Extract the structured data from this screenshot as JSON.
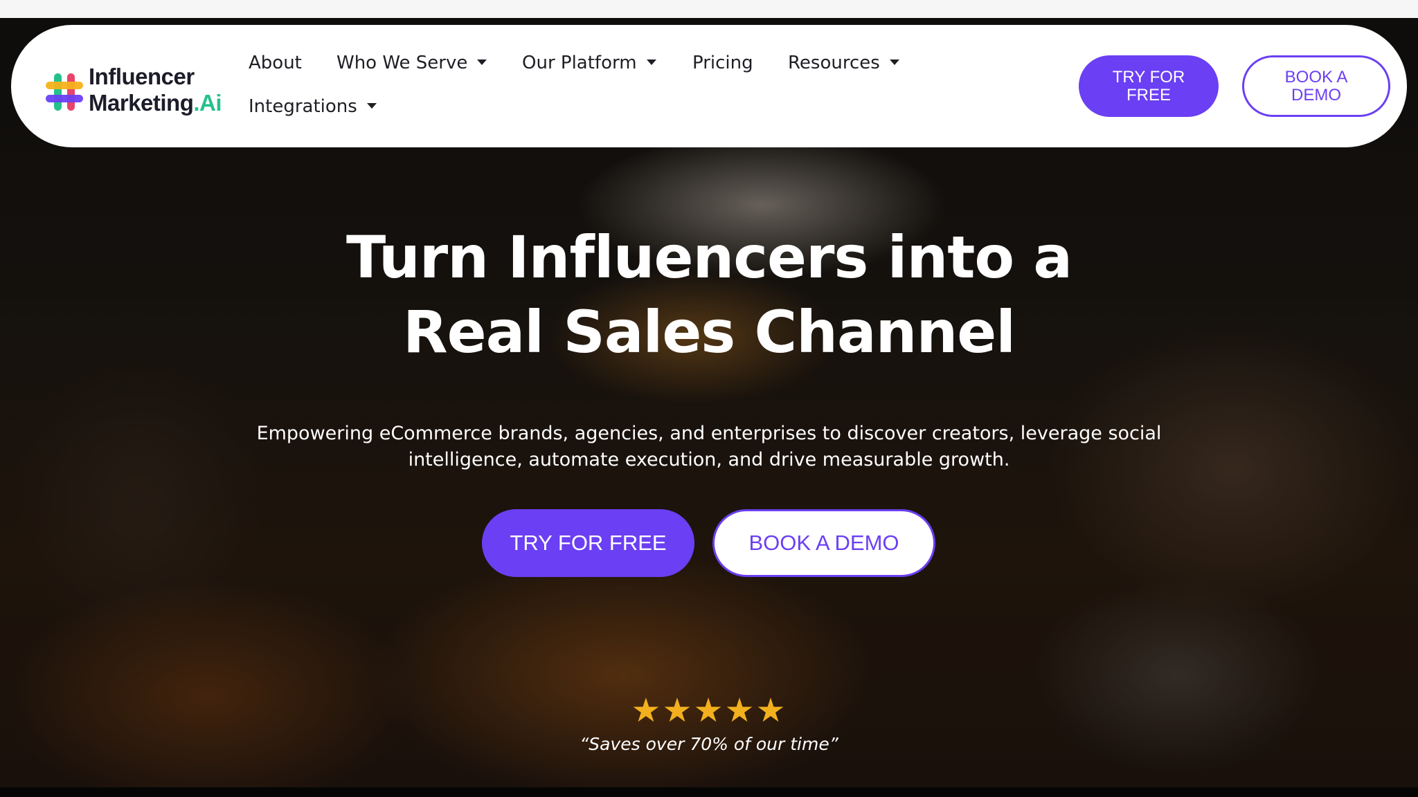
{
  "brand": {
    "name_line1": "Influencer",
    "name_line2": "Marketing",
    "name_suffix": ".Ai",
    "accent_color": "#6b3ff3",
    "logo_colors": [
      "#25c18b",
      "#e8456b",
      "#f6b21c",
      "#6b3ff3"
    ]
  },
  "nav": {
    "items": [
      {
        "label": "About",
        "has_dropdown": false
      },
      {
        "label": "Who We Serve",
        "has_dropdown": true
      },
      {
        "label": "Our Platform",
        "has_dropdown": true
      },
      {
        "label": "Pricing",
        "has_dropdown": false
      },
      {
        "label": "Resources",
        "has_dropdown": true
      },
      {
        "label": "Integrations",
        "has_dropdown": true
      }
    ],
    "try_line1": "TRY FOR",
    "try_line2": "FREE",
    "demo_line1": "BOOK A",
    "demo_line2": "DEMO"
  },
  "hero": {
    "headline_line1": "Turn Influencers into a",
    "headline_line2": "Real Sales Channel",
    "subtext_line1": "Empowering eCommerce brands, agencies, and enterprises to discover creators, leverage social",
    "subtext_line2": "intelligence, automate execution, and drive measurable growth.",
    "try_label": "TRY FOR FREE",
    "demo_label": "BOOK A DEMO",
    "rating_stars": 5,
    "stars_glyphs": "★★★★★",
    "quote": "“Saves over 70% of our time”",
    "star_color": "#f2b01e"
  }
}
